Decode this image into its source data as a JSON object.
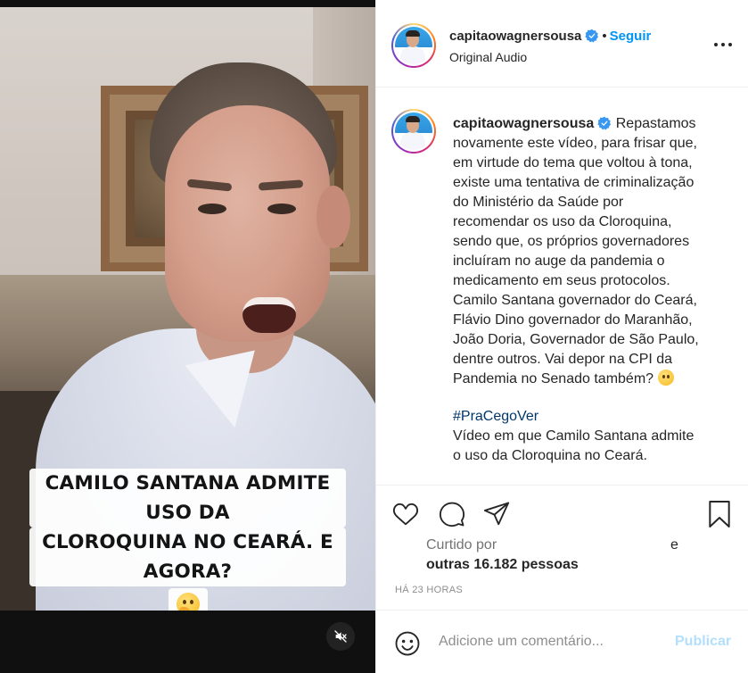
{
  "video": {
    "caption_line1": "CAMILO SANTANA ADMITE USO DA",
    "caption_line2": "CLOROQUINA NO CEARÁ. E AGORA?",
    "caption_emoji": "thinking-face-icon",
    "mute_icon": "speaker-muted-icon"
  },
  "header": {
    "username": "capitaowagnersousa",
    "verified_icon": "verified-badge-icon",
    "dot": "•",
    "follow_label": "Seguir",
    "audio": "Original Audio",
    "more_icon": "more-options-icon"
  },
  "post": {
    "username": "capitaowagnersousa",
    "caption": "Repastamos\nnovamente este vídeo, para frisar que,\nem virtude do tema que voltou à tona,\nexiste uma tentativa de criminalização\ndo Ministério da Saúde por\nrecomendar os uso da Cloroquina,\nsendo que, os próprios governadores\nincluíram no auge da pandemia o\nmedicamento em seus protocolos.\nCamilo Santana governador do Ceará,\nFlávio Dino governador do Maranhão,\nJoão Doria, Governador de São Paulo,\ndentre outros. Vai depor na CPI da\nPandemia no Senado também?",
    "caption_emoji": "thinking-face-icon",
    "hashtag": "#PraCegoVer",
    "alt_text": "Vídeo em que Camilo Santana admite\no uso da Cloroquina no Ceará."
  },
  "actions": {
    "like_icon": "heart-icon",
    "comment_icon": "comment-bubble-icon",
    "share_icon": "paper-plane-icon",
    "save_icon": "bookmark-icon"
  },
  "likes": {
    "prefix": "Curtido por",
    "connector": "e",
    "others": "outras 16.182 pessoas"
  },
  "timestamp": "HÁ 23 HORAS",
  "comment": {
    "emoji_icon": "smiley-icon",
    "placeholder": "Adicione um comentário...",
    "post_label": "Publicar"
  },
  "colors": {
    "link_blue": "#0095f6",
    "hashtag_blue": "#00376b",
    "post_disabled": "#b2dffc",
    "text": "#262626",
    "muted": "#8e8e8e"
  }
}
